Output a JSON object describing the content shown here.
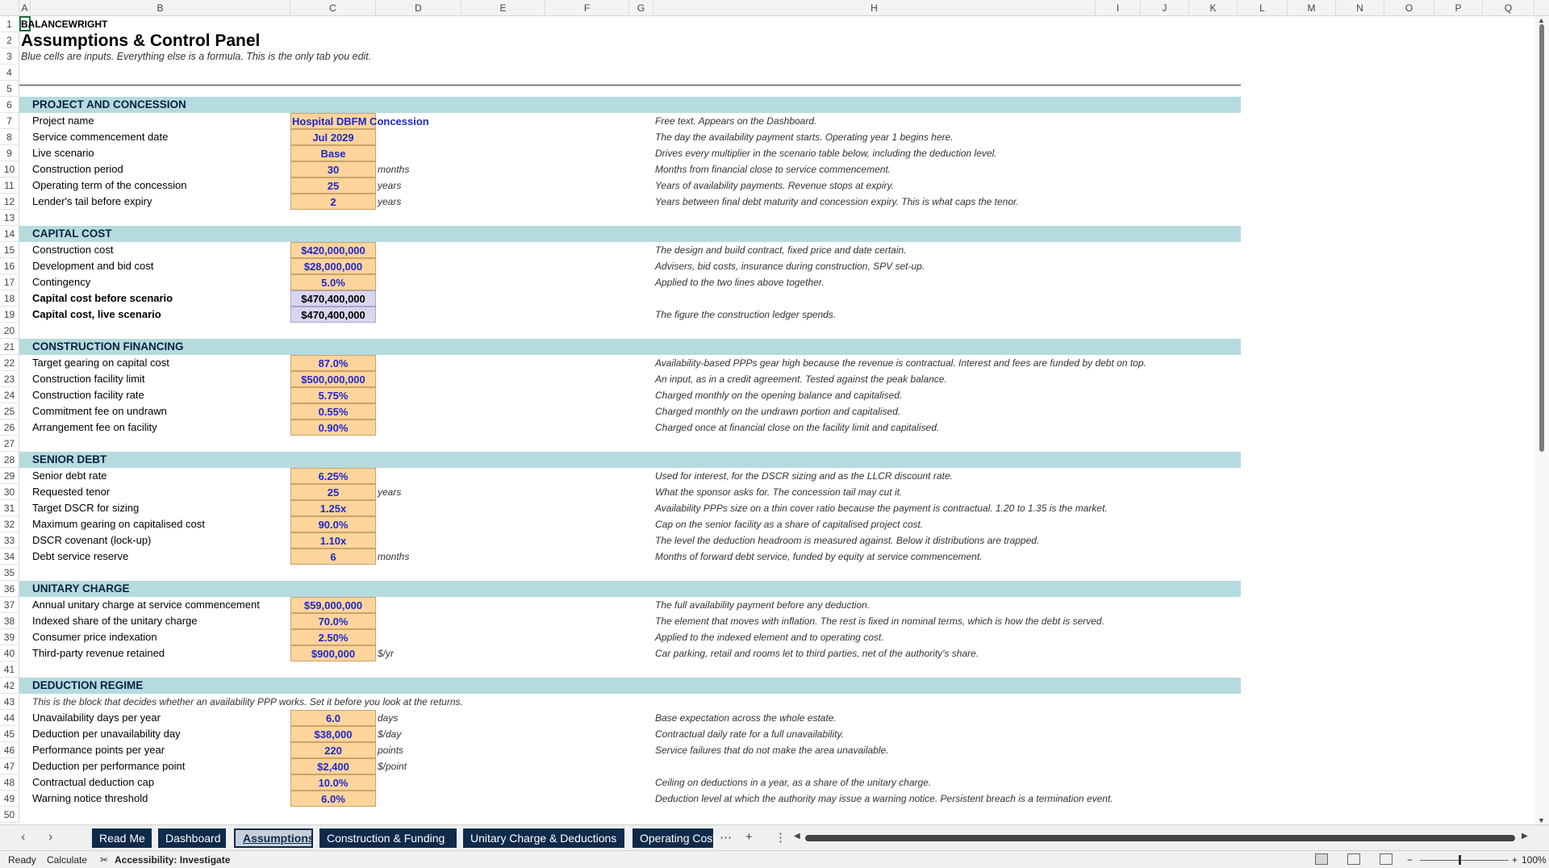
{
  "columns": [
    "A",
    "B",
    "C",
    "D",
    "E",
    "F",
    "G",
    "H",
    "I",
    "J",
    "K",
    "L",
    "M",
    "N",
    "O",
    "P",
    "Q"
  ],
  "brand": "BALANCEWRIGHT",
  "title": "Assumptions & Control Panel",
  "subtitle": "Blue cells are inputs. Everything else is a formula. This is the only tab you edit.",
  "sections": {
    "project": "PROJECT AND CONCESSION",
    "capital": "CAPITAL COST",
    "construction": "CONSTRUCTION FINANCING",
    "senior": "SENIOR DEBT",
    "unitary": "UNITARY CHARGE",
    "deduction": "DEDUCTION REGIME"
  },
  "deduction_intro": "This is the block that decides whether an availability PPP works. Set it before you look at the returns.",
  "rows": {
    "r7": {
      "label": "Project name",
      "value": "Hospital DBFM Concession",
      "unit": "",
      "note": "Free text. Appears on the Dashboard."
    },
    "r8": {
      "label": "Service commencement date",
      "value": "Jul 2029",
      "unit": "",
      "note": "The day the availability payment starts. Operating year 1 begins here."
    },
    "r9": {
      "label": "Live scenario",
      "value": "Base",
      "unit": "",
      "note": "Drives every multiplier in the scenario table below, including the deduction level."
    },
    "r10": {
      "label": "Construction period",
      "value": "30",
      "unit": "months",
      "note": "Months from financial close to service commencement."
    },
    "r11": {
      "label": "Operating term of the concession",
      "value": "25",
      "unit": "years",
      "note": "Years of availability payments. Revenue stops at expiry."
    },
    "r12": {
      "label": "Lender's tail before expiry",
      "value": "2",
      "unit": "years",
      "note": "Years between final debt maturity and concession expiry. This is what caps the tenor."
    },
    "r15": {
      "label": "Construction cost",
      "value": "$420,000,000",
      "unit": "",
      "note": "The design and build contract, fixed price and date certain."
    },
    "r16": {
      "label": "Development and bid cost",
      "value": "$28,000,000",
      "unit": "",
      "note": "Advisers, bid costs, insurance during construction, SPV set-up."
    },
    "r17": {
      "label": "Contingency",
      "value": "5.0%",
      "unit": "",
      "note": "Applied to the two lines above together."
    },
    "r18": {
      "label": "Capital cost before scenario",
      "value": "$470,400,000",
      "unit": "",
      "note": ""
    },
    "r19": {
      "label": "Capital cost, live scenario",
      "value": "$470,400,000",
      "unit": "",
      "note": "The figure the construction ledger spends."
    },
    "r22": {
      "label": "Target gearing on capital cost",
      "value": "87.0%",
      "unit": "",
      "note": "Availability-based PPPs gear high because the revenue is contractual. Interest and fees are funded by debt on top."
    },
    "r23": {
      "label": "Construction facility limit",
      "value": "$500,000,000",
      "unit": "",
      "note": "An input, as in a credit agreement. Tested against the peak balance."
    },
    "r24": {
      "label": "Construction facility rate",
      "value": "5.75%",
      "unit": "",
      "note": "Charged monthly on the opening balance and capitalised."
    },
    "r25": {
      "label": "Commitment fee on undrawn",
      "value": "0.55%",
      "unit": "",
      "note": "Charged monthly on the undrawn portion and capitalised."
    },
    "r26": {
      "label": "Arrangement fee on facility",
      "value": "0.90%",
      "unit": "",
      "note": "Charged once at financial close on the facility limit and capitalised."
    },
    "r29": {
      "label": "Senior debt rate",
      "value": "6.25%",
      "unit": "",
      "note": "Used for interest, for the DSCR sizing and as the LLCR discount rate."
    },
    "r30": {
      "label": "Requested tenor",
      "value": "25",
      "unit": "years",
      "note": "What the sponsor asks for. The concession tail may cut it."
    },
    "r31": {
      "label": "Target DSCR for sizing",
      "value": "1.25x",
      "unit": "",
      "note": "Availability PPPs size on a thin cover ratio because the payment is contractual. 1.20 to 1.35 is the market."
    },
    "r32": {
      "label": "Maximum gearing on capitalised cost",
      "value": "90.0%",
      "unit": "",
      "note": "Cap on the senior facility as a share of capitalised project cost."
    },
    "r33": {
      "label": "DSCR covenant (lock-up)",
      "value": "1.10x",
      "unit": "",
      "note": "The level the deduction headroom is measured against. Below it distributions are trapped."
    },
    "r34": {
      "label": "Debt service reserve",
      "value": "6",
      "unit": "months",
      "note": "Months of forward debt service, funded by equity at service commencement."
    },
    "r37": {
      "label": "Annual unitary charge at service commencement",
      "value": "$59,000,000",
      "unit": "",
      "note": "The full availability payment before any deduction."
    },
    "r38": {
      "label": "Indexed share of the unitary charge",
      "value": "70.0%",
      "unit": "",
      "note": "The element that moves with inflation. The rest is fixed in nominal terms, which is how the debt is served."
    },
    "r39": {
      "label": "Consumer price indexation",
      "value": "2.50%",
      "unit": "",
      "note": "Applied to the indexed element and to operating cost."
    },
    "r40": {
      "label": "Third-party revenue retained",
      "value": "$900,000",
      "unit": "$/yr",
      "note": "Car parking, retail and rooms let to third parties, net of the authority's share."
    },
    "r44": {
      "label": "Unavailability days per year",
      "value": "6.0",
      "unit": "days",
      "note": "Base expectation across the whole estate."
    },
    "r45": {
      "label": "Deduction per unavailability day",
      "value": "$38,000",
      "unit": "$/day",
      "note": "Contractual daily rate for a full unavailability."
    },
    "r46": {
      "label": "Performance points per year",
      "value": "220",
      "unit": "points",
      "note": "Service failures that do not make the area unavailable."
    },
    "r47": {
      "label": "Deduction per performance point",
      "value": "$2,400",
      "unit": "$/point",
      "note": ""
    },
    "r48": {
      "label": "Contractual deduction cap",
      "value": "10.0%",
      "unit": "",
      "note": "Ceiling on deductions in a year, as a share of the unitary charge."
    },
    "r49": {
      "label": "Warning notice threshold",
      "value": "6.0%",
      "unit": "",
      "note": "Deduction level at which the authority may issue a warning notice. Persistent breach is a termination event."
    }
  },
  "tabs": [
    "Read Me",
    "Dashboard",
    "Assumptions",
    "Construction & Funding",
    "Unitary Charge & Deductions",
    "Operating Cost"
  ],
  "active_tab": "Assumptions",
  "status": {
    "ready": "Ready",
    "calculate": "Calculate",
    "accessibility": "Accessibility: Investigate",
    "zoom": "100%"
  },
  "colors": {
    "input_fill": "#fdd49c",
    "input_text": "#1f29c9",
    "section_fill": "#b5dbdf",
    "tab_fill": "#0f2a4a",
    "calc_fill": "#d9d6f0"
  },
  "icons": [
    "chevron-left-icon",
    "chevron-right-icon",
    "more-icon",
    "plus-icon",
    "options-icon",
    "accessibility-icon",
    "normal-view-icon",
    "page-layout-icon",
    "page-break-icon"
  ]
}
